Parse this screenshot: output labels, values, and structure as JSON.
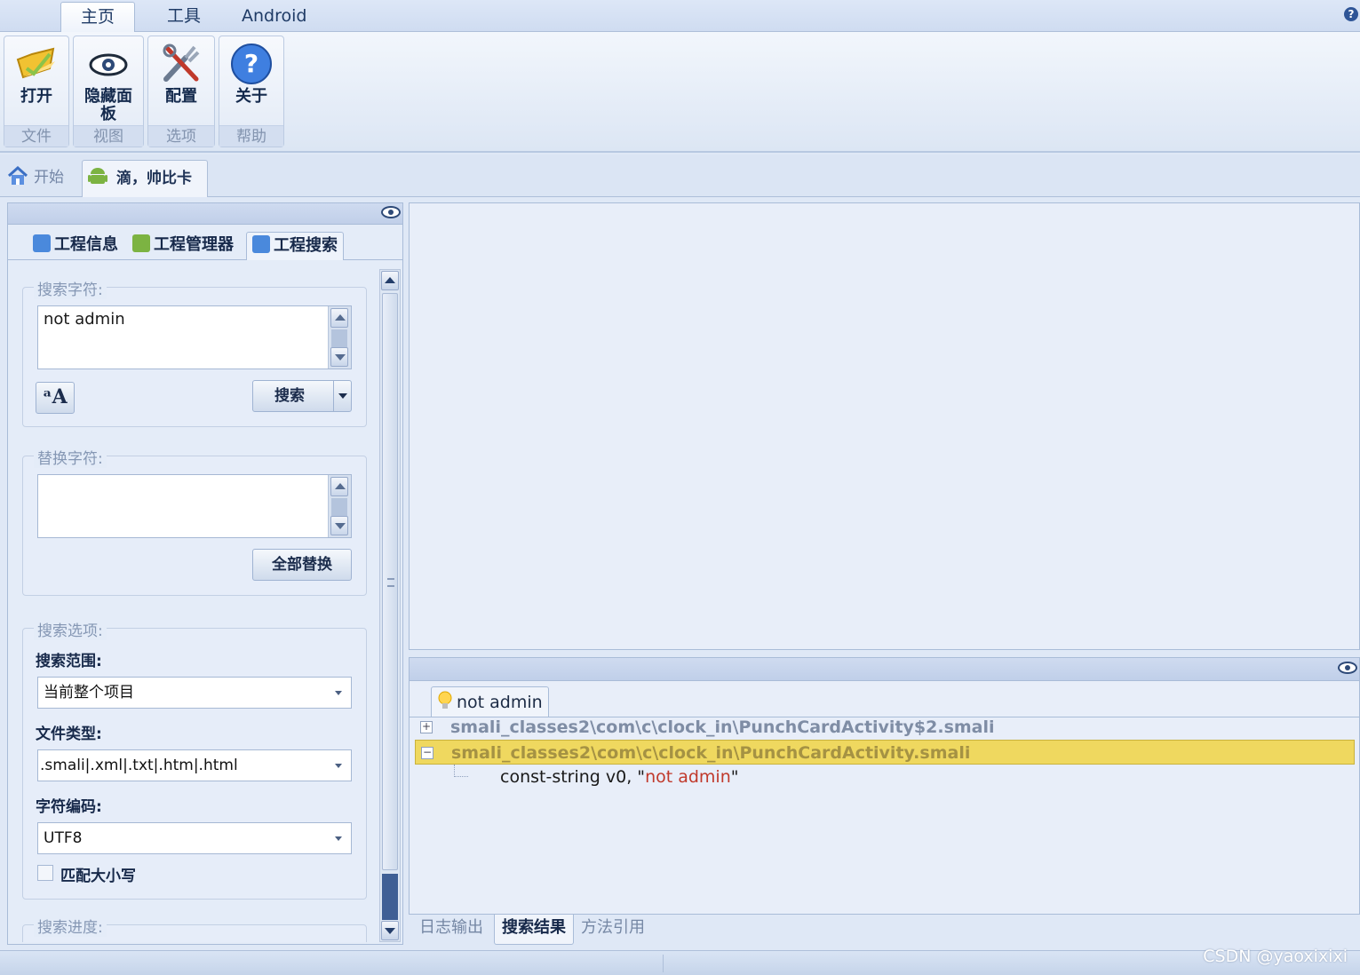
{
  "ribbon": {
    "tabs": [
      "主页",
      "工具",
      "Android"
    ],
    "active_tab": "主页",
    "groups": [
      {
        "button": "打开",
        "group": "文件",
        "icon": "open-folder-icon"
      },
      {
        "button": "隐藏面板",
        "group": "视图",
        "icon": "eye-icon"
      },
      {
        "button": "配置",
        "group": "选项",
        "icon": "tools-icon"
      },
      {
        "button": "关于",
        "group": "帮助",
        "icon": "help-icon"
      }
    ]
  },
  "doc_tabs": [
    {
      "label": "开始",
      "icon": "home-icon"
    },
    {
      "label": "滴，帅比卡",
      "icon": "android-icon",
      "active": true
    }
  ],
  "left_panel": {
    "tabs": [
      "工程信息",
      "工程管理器",
      "工程搜索"
    ],
    "active_tab": "工程搜索",
    "search": {
      "legend": "搜索字符:",
      "value": "not admin",
      "search_button": "搜索"
    },
    "replace": {
      "legend": "替换字符:",
      "value": "",
      "replace_all_button": "全部替换"
    },
    "options": {
      "legend": "搜索选项:",
      "scope_label": "搜索范围:",
      "scope_value": "当前整个项目",
      "filetype_label": "文件类型:",
      "filetype_value": ".smali|.xml|.txt|.htm|.html",
      "encoding_label": "字符编码:",
      "encoding_value": "UTF8",
      "match_case_label": "匹配大小写",
      "match_case_checked": false
    },
    "progress_legend": "搜索进度:"
  },
  "results": {
    "tab_label": "not admin",
    "rows": [
      {
        "expander": "+",
        "text": "smali_classes2\\com\\c\\clock_in\\PunchCardActivity$2.smali",
        "selected": false
      },
      {
        "expander": "−",
        "text": "smali_classes2\\com\\c\\clock_in\\PunchCardActivity.smali",
        "selected": true
      }
    ],
    "code_prefix": "const-string v0, \"",
    "code_string": "not admin",
    "code_suffix": "\""
  },
  "bottom_tabs": [
    "日志输出",
    "搜索结果",
    "方法引用"
  ],
  "active_bottom_tab": "搜索结果",
  "watermark": "CSDN @yaoxixixi",
  "colors": {
    "selection": "#efd85f",
    "accent": "#3f5f95",
    "string_literal": "#c0392b"
  }
}
